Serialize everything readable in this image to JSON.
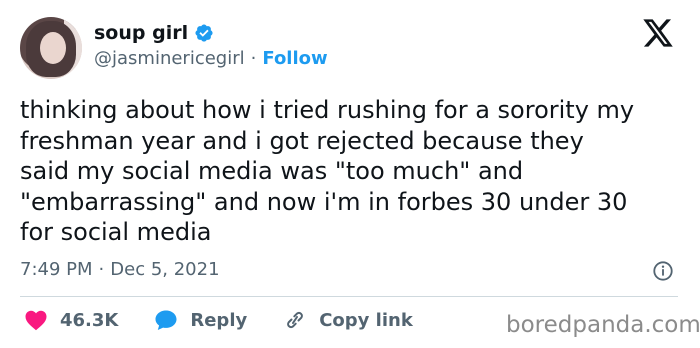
{
  "user": {
    "display_name": "soup girl",
    "handle": "@jasminericegirl",
    "separator": "·",
    "follow_label": "Follow"
  },
  "tweet": {
    "text": "thinking about how i tried rushing for a sorority my\nfreshman year and i got rejected because they\nsaid my social media was \"too much\" and\n\"embarrassing\" and now i'm in forbes 30 under 30\nfor social media",
    "time": "7:49 PM",
    "separator": "·",
    "date": "Dec 5, 2021"
  },
  "actions": {
    "likes": "46.3K",
    "reply_label": "Reply",
    "copy_link_label": "Copy link"
  },
  "watermark": "boredpanda.com",
  "colors": {
    "accent": "#1d9bf0",
    "like": "#f91880",
    "muted": "#536471",
    "text": "#0f1419"
  },
  "icons": [
    "avatar",
    "verified-badge-icon",
    "x-logo-icon",
    "info-icon",
    "heart-icon",
    "reply-bubble-icon",
    "link-icon"
  ]
}
